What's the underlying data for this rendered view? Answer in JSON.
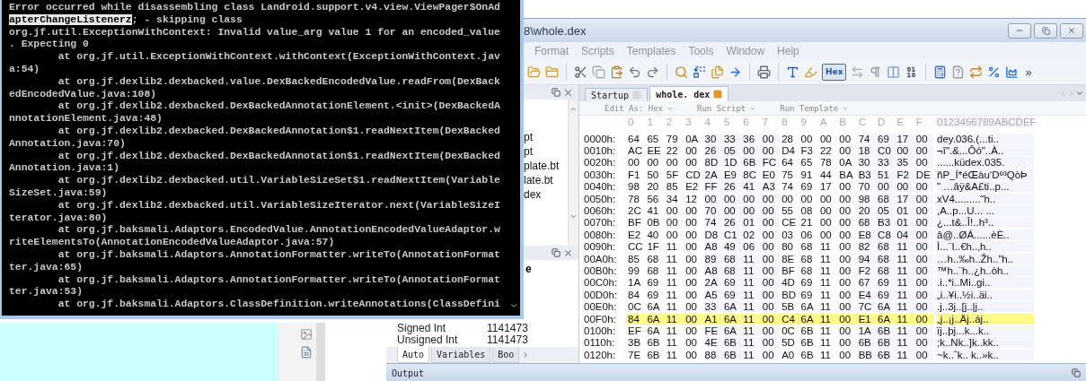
{
  "console": {
    "lines": [
      {
        "segments": [
          {
            "text": "Error occurred while disassembling class Landroid.support.v4.view.ViewPager$OnAd",
            "selected": false
          }
        ]
      },
      {
        "segments": [
          {
            "text": "apterChangeListenerz",
            "selected": true
          },
          {
            "text": "; - skipping class",
            "selected": false
          }
        ]
      },
      {
        "segments": [
          {
            "text": "org.jf.util.ExceptionWithContext: Invalid value_arg value 1 for an encoded_value",
            "selected": false
          }
        ]
      },
      {
        "segments": [
          {
            "text": ". Expecting 0",
            "selected": false
          }
        ]
      },
      {
        "segments": [
          {
            "text": "        at org.jf.util.ExceptionWithContext.withContext(ExceptionWithContext.jav",
            "selected": false
          }
        ]
      },
      {
        "segments": [
          {
            "text": "a:54)",
            "selected": false
          }
        ]
      },
      {
        "segments": [
          {
            "text": "        at org.jf.dexlib2.dexbacked.value.DexBackedEncodedValue.readFrom(DexBack",
            "selected": false
          }
        ]
      },
      {
        "segments": [
          {
            "text": "edEncodedValue.java:108)",
            "selected": false
          }
        ]
      },
      {
        "segments": [
          {
            "text": "        at org.jf.dexlib2.dexbacked.DexBackedAnnotationElement.<init>(DexBackedA",
            "selected": false
          }
        ]
      },
      {
        "segments": [
          {
            "text": "nnotationElement.java:48)",
            "selected": false
          }
        ]
      },
      {
        "segments": [
          {
            "text": "        at org.jf.dexlib2.dexbacked.DexBackedAnnotation$1.readNextItem(DexBacked",
            "selected": false
          }
        ]
      },
      {
        "segments": [
          {
            "text": "Annotation.java:70)",
            "selected": false
          }
        ]
      },
      {
        "segments": [
          {
            "text": "        at org.jf.dexlib2.dexbacked.DexBackedAnnotation$1.readNextItem(DexBacked",
            "selected": false
          }
        ]
      },
      {
        "segments": [
          {
            "text": "Annotation.java:1)",
            "selected": false
          }
        ]
      },
      {
        "segments": [
          {
            "text": "        at org.jf.dexlib2.dexbacked.util.VariableSizeSet$1.readNextItem(Variable",
            "selected": false
          }
        ]
      },
      {
        "segments": [
          {
            "text": "SizeSet.java:59)",
            "selected": false
          }
        ]
      },
      {
        "segments": [
          {
            "text": "        at org.jf.dexlib2.dexbacked.util.VariableSizeIterator.next(VariableSizeI",
            "selected": false
          }
        ]
      },
      {
        "segments": [
          {
            "text": "terator.java:80)",
            "selected": false
          }
        ]
      },
      {
        "segments": [
          {
            "text": "        at org.jf.baksmali.Adaptors.EncodedValue.AnnotationEncodedValueAdaptor.w",
            "selected": false
          }
        ]
      },
      {
        "segments": [
          {
            "text": "riteElementsTo(AnnotationEncodedValueAdaptor.java:57)",
            "selected": false
          }
        ]
      },
      {
        "segments": [
          {
            "text": "        at org.jf.baksmali.Adaptors.AnnotationFormatter.writeTo(AnnotationFormat",
            "selected": false
          }
        ]
      },
      {
        "segments": [
          {
            "text": "ter.java:65)",
            "selected": false
          }
        ]
      },
      {
        "segments": [
          {
            "text": "        at org.jf.baksmali.Adaptors.AnnotationFormatter.writeTo(AnnotationFormat",
            "selected": false
          }
        ]
      },
      {
        "segments": [
          {
            "text": "ter.java:53)",
            "selected": false
          }
        ]
      },
      {
        "segments": [
          {
            "text": "        at org.jf.baksmali.Adaptors.ClassDefinition.writeAnnotations(ClassDefini",
            "selected": false
          }
        ]
      }
    ]
  },
  "editor": {
    "title": "8\\whole.dex",
    "menu": [
      {
        "label": "Format"
      },
      {
        "label": "Scripts"
      },
      {
        "label": "Templates"
      },
      {
        "label": "Tools"
      },
      {
        "label": "Window"
      },
      {
        "label": "Help"
      }
    ],
    "toolbar": {
      "hex_toggle": {
        "label": "Hex",
        "on": true
      },
      "overflow": "»"
    },
    "file_panel": {
      "items": [
        {
          "label": "pt"
        },
        {
          "label": "pt"
        },
        {
          "label": "plate.bt"
        },
        {
          "label": "late.bt"
        },
        {
          "label": "dex"
        }
      ]
    },
    "tabs": [
      {
        "label": "Startup",
        "selected": false
      },
      {
        "label": "whole. dex",
        "selected": true
      }
    ],
    "edit_bar": [
      {
        "label": "Edit As: Hex"
      },
      {
        "label": "Run Script"
      },
      {
        "label": "Run Template"
      }
    ],
    "hex": {
      "columns": [
        "0",
        "1",
        "2",
        "3",
        "4",
        "5",
        "6",
        "7",
        "8",
        "9",
        "A",
        "B",
        "C",
        "D",
        "E",
        "F"
      ],
      "ascii_header": "0123456789ABCDEF",
      "rows": [
        {
          "offset": "0000h:",
          "bytes": "64 65 79 0A 30 33 36 00 28 00 00 00 74 69 17 00",
          "ascii": "dey.036.(...ti..",
          "selected": false
        },
        {
          "offset": "0010h:",
          "bytes": "AC EE 22 00 26 05 00 00 D4 F3 22 00 18 C0 00 00",
          "ascii": "¬î\".&...Ôó\"..À..",
          "selected": false
        },
        {
          "offset": "0020h:",
          "bytes": "00 00 00 00 8D 1D 6B FC 64 65 78 0A 30 33 35 00",
          "ascii": "......küdex.035.",
          "selected": false
        },
        {
          "offset": "0030h:",
          "bytes": "F1 50 5F CD 2A E9 8C E0 75 91 44 BA B3 51 F2 DE",
          "ascii": "ñP_Í*éŒàu‘Dº³QòÞ",
          "selected": false
        },
        {
          "offset": "0040h:",
          "bytes": "98 20 85 E2 FF 26 41 A3 74 69 17 00 70 00 00 00",
          "ascii": "˜ …âÿ&A£ti..p...",
          "selected": false
        },
        {
          "offset": "0050h:",
          "bytes": "78 56 34 12 00 00 00 00 00 00 00 00 98 68 17 00",
          "ascii": "xV4.........˜h..",
          "selected": false
        },
        {
          "offset": "0060h:",
          "bytes": "2C 41 00 00 70 00 00 00 55 08 00 00 20 05 01 00",
          "ascii": ",A..p...U... ...",
          "selected": false
        },
        {
          "offset": "0070h:",
          "bytes": "BF 0B 00 00 74 26 01 00 CE 21 00 00 68 B3 01 00",
          "ascii": "¿...t&..Î!..h³..",
          "selected": false
        },
        {
          "offset": "0080h:",
          "bytes": "E2 40 00 00 D8 C1 02 00 03 06 00 00 E8 C8 04 00",
          "ascii": "â@..ØÁ......èÈ..",
          "selected": false
        },
        {
          "offset": "0090h:",
          "bytes": "CC 1F 11 00 A8 49 06 00 80 68 11 00 82 68 11 00",
          "ascii": "Ì...¨I..€h..‚h..",
          "selected": false
        },
        {
          "offset": "00A0h:",
          "bytes": "85 68 11 00 89 68 11 00 8E 68 11 00 94 68 11 00",
          "ascii": "…h..‰h..Žh..”h..",
          "selected": false
        },
        {
          "offset": "00B0h:",
          "bytes": "99 68 11 00 A8 68 11 00 BF 68 11 00 F2 68 11 00",
          "ascii": "™h..¨h..¿h..òh..",
          "selected": false
        },
        {
          "offset": "00C0h:",
          "bytes": "1A 69 11 00 2A 69 11 00 4D 69 11 00 67 69 11 00",
          "ascii": ".i..*i..Mi..gi..",
          "selected": false
        },
        {
          "offset": "00D0h:",
          "bytes": "84 69 11 00 A5 69 11 00 BD 69 11 00 E4 69 11 00",
          "ascii": "„i..¥i..½i..äi..",
          "selected": false
        },
        {
          "offset": "00E0h:",
          "bytes": "0C 6A 11 00 33 6A 11 00 5B 6A 11 00 7C 6A 11 00",
          "ascii": ".j..3j..[j..|j..",
          "selected": false
        },
        {
          "offset": "00F0h:",
          "bytes": "84 6A 11 00 A1 6A 11 00 C4 6A 11 00 E1 6A 11 00",
          "ascii": "„j..¡j..Äj..áj..",
          "selected": true
        },
        {
          "offset": "0100h:",
          "bytes": "EF 6A 11 00 FE 6A 11 00 0C 6B 11 00 1A 6B 11 00",
          "ascii": "ïj..þj...k...k..",
          "selected": false
        },
        {
          "offset": "0110h:",
          "bytes": "3B 6B 11 00 4E 6B 11 00 5D 6B 11 00 6B 6B 11 00",
          "ascii": ";k..Nk..]k..kk..",
          "selected": false
        },
        {
          "offset": "0120h:",
          "bytes": "7E 6B 11 00 88 6B 11 00 A0 6B 11 00 BB 6B 11 00",
          "ascii": "~k..ˆk.. k..»k..",
          "selected": false
        }
      ]
    },
    "inspector": {
      "column_header": "e",
      "rows": [
        {
          "name": "Signed Int",
          "value": "1141473"
        },
        {
          "name": "Unsigned Int",
          "value": "1141473"
        }
      ],
      "tabs": [
        {
          "label": "Auto",
          "selected": true
        },
        {
          "label": "Variables",
          "selected": false
        },
        {
          "label": "Boo",
          "selected": false
        }
      ]
    },
    "output": {
      "title": "Output"
    }
  }
}
